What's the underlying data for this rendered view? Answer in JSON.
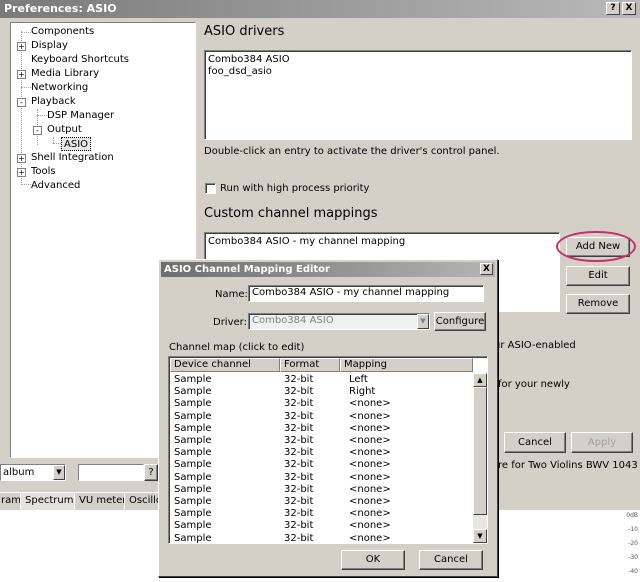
{
  "window": {
    "title": "Preferences: ASIO",
    "help": "?",
    "close": "X"
  },
  "tree": {
    "items": [
      {
        "label": "Components"
      },
      {
        "label": "Display",
        "expander": "+"
      },
      {
        "label": "Keyboard Shortcuts"
      },
      {
        "label": "Media Library",
        "expander": "+"
      },
      {
        "label": "Networking"
      },
      {
        "label": "Playback",
        "expander": "-"
      },
      {
        "label": "DSP Manager"
      },
      {
        "label": "Output",
        "expander": "-"
      },
      {
        "label": "ASIO",
        "selected": true
      },
      {
        "label": "Shell Integration",
        "expander": "+"
      },
      {
        "label": "Tools",
        "expander": "+"
      },
      {
        "label": "Advanced"
      }
    ]
  },
  "asio": {
    "drivers_title": "ASIO drivers",
    "drivers": [
      "Combo384 ASIO",
      "foo_dsd_asio"
    ],
    "hint": "Double-click an entry to activate the driver's control panel.",
    "high_priority_label": "Run with high process priority",
    "mappings_title": "Custom channel mappings",
    "mappings": [
      "Combo384 ASIO - my channel mapping"
    ],
    "add_new": "Add New",
    "edit": "Edit",
    "remove": "Remove",
    "partial_text_1": "ur ASIO-enabled",
    "partial_text_2": "for your newly",
    "cancel": "Cancel",
    "apply": "Apply"
  },
  "bottom": {
    "combo_value": "album",
    "help": "?",
    "tabs": [
      "ram",
      "Spectrum",
      "VU meter",
      "Oscillo"
    ],
    "track_text": "re for Two Violins BWV 1043",
    "db_labels": [
      "0dB",
      "-10",
      "-20",
      "-30",
      "-40"
    ]
  },
  "dialog": {
    "title": "ASIO Channel Mapping Editor",
    "close": "X",
    "name_label": "Name:",
    "name_value": "Combo384 ASIO - my channel mapping",
    "driver_label": "Driver:",
    "driver_value": "Combo384 ASIO",
    "configure": "Configure",
    "channel_map_label": "Channel map (click to edit)",
    "columns": [
      "Device channel",
      "Format",
      "Mapping"
    ],
    "rows": [
      [
        "Sample",
        "32-bit",
        "Left"
      ],
      [
        "Sample",
        "32-bit",
        "Right"
      ],
      [
        "Sample",
        "32-bit",
        "<none>"
      ],
      [
        "Sample",
        "32-bit",
        "<none>"
      ],
      [
        "Sample",
        "32-bit",
        "<none>"
      ],
      [
        "Sample",
        "32-bit",
        "<none>"
      ],
      [
        "Sample",
        "32-bit",
        "<none>"
      ],
      [
        "Sample",
        "32-bit",
        "<none>"
      ],
      [
        "Sample",
        "32-bit",
        "<none>"
      ],
      [
        "Sample",
        "32-bit",
        "<none>"
      ],
      [
        "Sample",
        "32-bit",
        "<none>"
      ],
      [
        "Sample",
        "32-bit",
        "<none>"
      ],
      [
        "Sample",
        "32-bit",
        "<none>"
      ],
      [
        "Sample",
        "32-bit",
        "<none>"
      ]
    ],
    "ok": "OK",
    "cancel": "Cancel"
  },
  "colors": {
    "highlight_ring": "#c8306a",
    "titlebar": "#7a7a7a"
  }
}
